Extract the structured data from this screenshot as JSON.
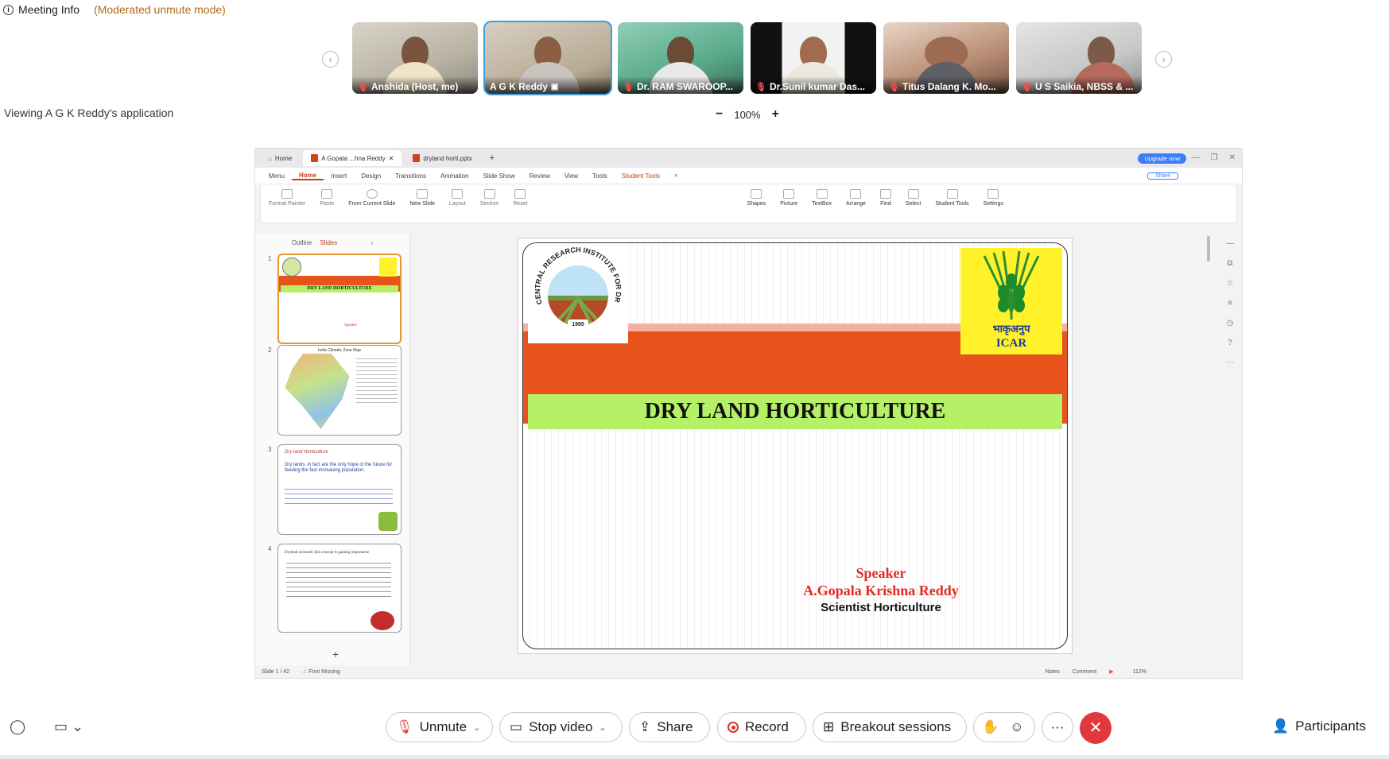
{
  "meeting": {
    "info_label": "Meeting Info",
    "mode_label": "(Moderated unmute mode)",
    "viewing_text": "Viewing A G K Reddy's application",
    "zoom_level": "100%",
    "zoom_minus": "−",
    "zoom_plus": "+"
  },
  "participants_strip": {
    "prev": "‹",
    "next": "›",
    "tiles": [
      {
        "name": "Anshida (Host, me)",
        "muted": true,
        "active": false
      },
      {
        "name": "A G K Reddy",
        "muted": false,
        "active": true
      },
      {
        "name": "Dr. RAM SWAROOP...",
        "muted": true,
        "active": false
      },
      {
        "name": "Dr.Sunil kumar Das...",
        "muted": true,
        "active": false
      },
      {
        "name": "Titus Dalang K. Mo...",
        "muted": true,
        "active": false
      },
      {
        "name": "U S Saikia, NBSS & ...",
        "muted": true,
        "active": false
      }
    ]
  },
  "app": {
    "tabs": [
      "Home",
      "A Gopala ...hna Reddy",
      "dryland horti.pptx"
    ],
    "upgrade_label": "Upgrade now",
    "ribbon_tabs": [
      "Menu",
      "Home",
      "Insert",
      "Design",
      "Transitions",
      "Animation",
      "Slide Show",
      "Review",
      "View",
      "Tools",
      "Student Tools"
    ],
    "share_label": "Share",
    "ribbon_items": [
      "Format Painter",
      "Paste",
      "From Current Slide",
      "New Slide",
      "Layout",
      "Section",
      "Reset",
      "Shapes",
      "Picture",
      "TextBox",
      "Arrange",
      "Find",
      "Select",
      "Student Tools",
      "Settings"
    ],
    "panel_tabs": {
      "outline": "Outline",
      "slides": "Slides"
    },
    "thumb_numbers": [
      "1",
      "2",
      "3",
      "4"
    ],
    "thumb_add": "+",
    "status": {
      "slide": "Slide 1 / 42",
      "font": "Font Missing",
      "notes": "Notes",
      "comment": "Comment",
      "zoom": "112%"
    }
  },
  "slide": {
    "title": "DRY LAND HORTICULTURE",
    "speaker_label": "Speaker",
    "speaker_name": "A.Gopala Krishna Reddy",
    "speaker_role": "Scientist Horticulture",
    "cria_text": "CENTRAL RESEARCH INSTITUTE FOR DRYLAND AGRICULTURE",
    "cria_year": "1985",
    "icar_hindi": "भाकृअनुप",
    "icar_text": "ICAR"
  },
  "thumbs": {
    "t1_title": "DRY LAND HORTICULTURE",
    "t1_speaker": "Speaker",
    "t2_title": "India Climatic Zone Map",
    "t3_title": "Dry land Horticulture",
    "t3_body": "Dry lands, in fact are the only hope of the future for feeding the fast increasing population.",
    "t4_body": "Dryland orchards: this concept is gaining importance"
  },
  "controls": {
    "unmute": "Unmute",
    "stop_video": "Stop video",
    "share": "Share",
    "record": "Record",
    "breakout": "Breakout sessions",
    "more": "···",
    "end": "✕",
    "participants": "Participants"
  }
}
